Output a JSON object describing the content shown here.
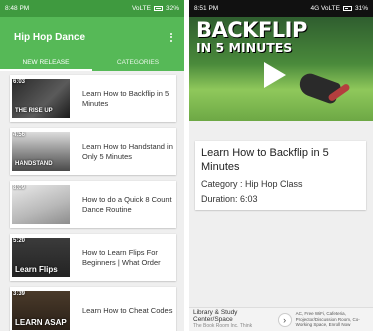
{
  "left": {
    "status": {
      "time": "8:48 PM",
      "network": "VoLTE",
      "battery": "32%"
    },
    "app_title": "Hip Hop Dance",
    "tabs": [
      "NEW RELEASE",
      "CATEGORIES"
    ],
    "videos": [
      {
        "duration": "6:03",
        "thumb_label": "THE RISE UP",
        "title": "Learn How to Backflip in 5 Minutes"
      },
      {
        "duration": "4:56",
        "thumb_label": "HANDSTAND",
        "title": "Learn How to Handstand in Only 5 Minutes"
      },
      {
        "duration": "8:09",
        "thumb_label": "",
        "title": "How to do a Quick 8 Count Dance Routine"
      },
      {
        "duration": "5:20",
        "thumb_label": "Learn Flips",
        "title": "How to Learn Flips For Beginners | What Order"
      },
      {
        "duration": "3:39",
        "thumb_label": "LEARN ASAP",
        "title": "Learn How to Cheat Codes"
      }
    ]
  },
  "right": {
    "status": {
      "time": "8:51 PM",
      "network": "4G VoLTE",
      "battery": "31%"
    },
    "video_title_line1": "BACKFLIP",
    "video_title_line2": "IN 5 MINUTES",
    "title": "Learn How to Backflip in 5 Minutes",
    "category": "Category : Hip Hop Class",
    "duration": "Duration: 6:03",
    "ad": {
      "left_title": "Library & Study Center/Space",
      "left_sub": "The Book Room Inc. Think",
      "arrow": "›",
      "right_text": "AC, Free WiFi, Cafeteria, Projector/Discussion Room, Co-Working Space, Enroll Now"
    }
  }
}
